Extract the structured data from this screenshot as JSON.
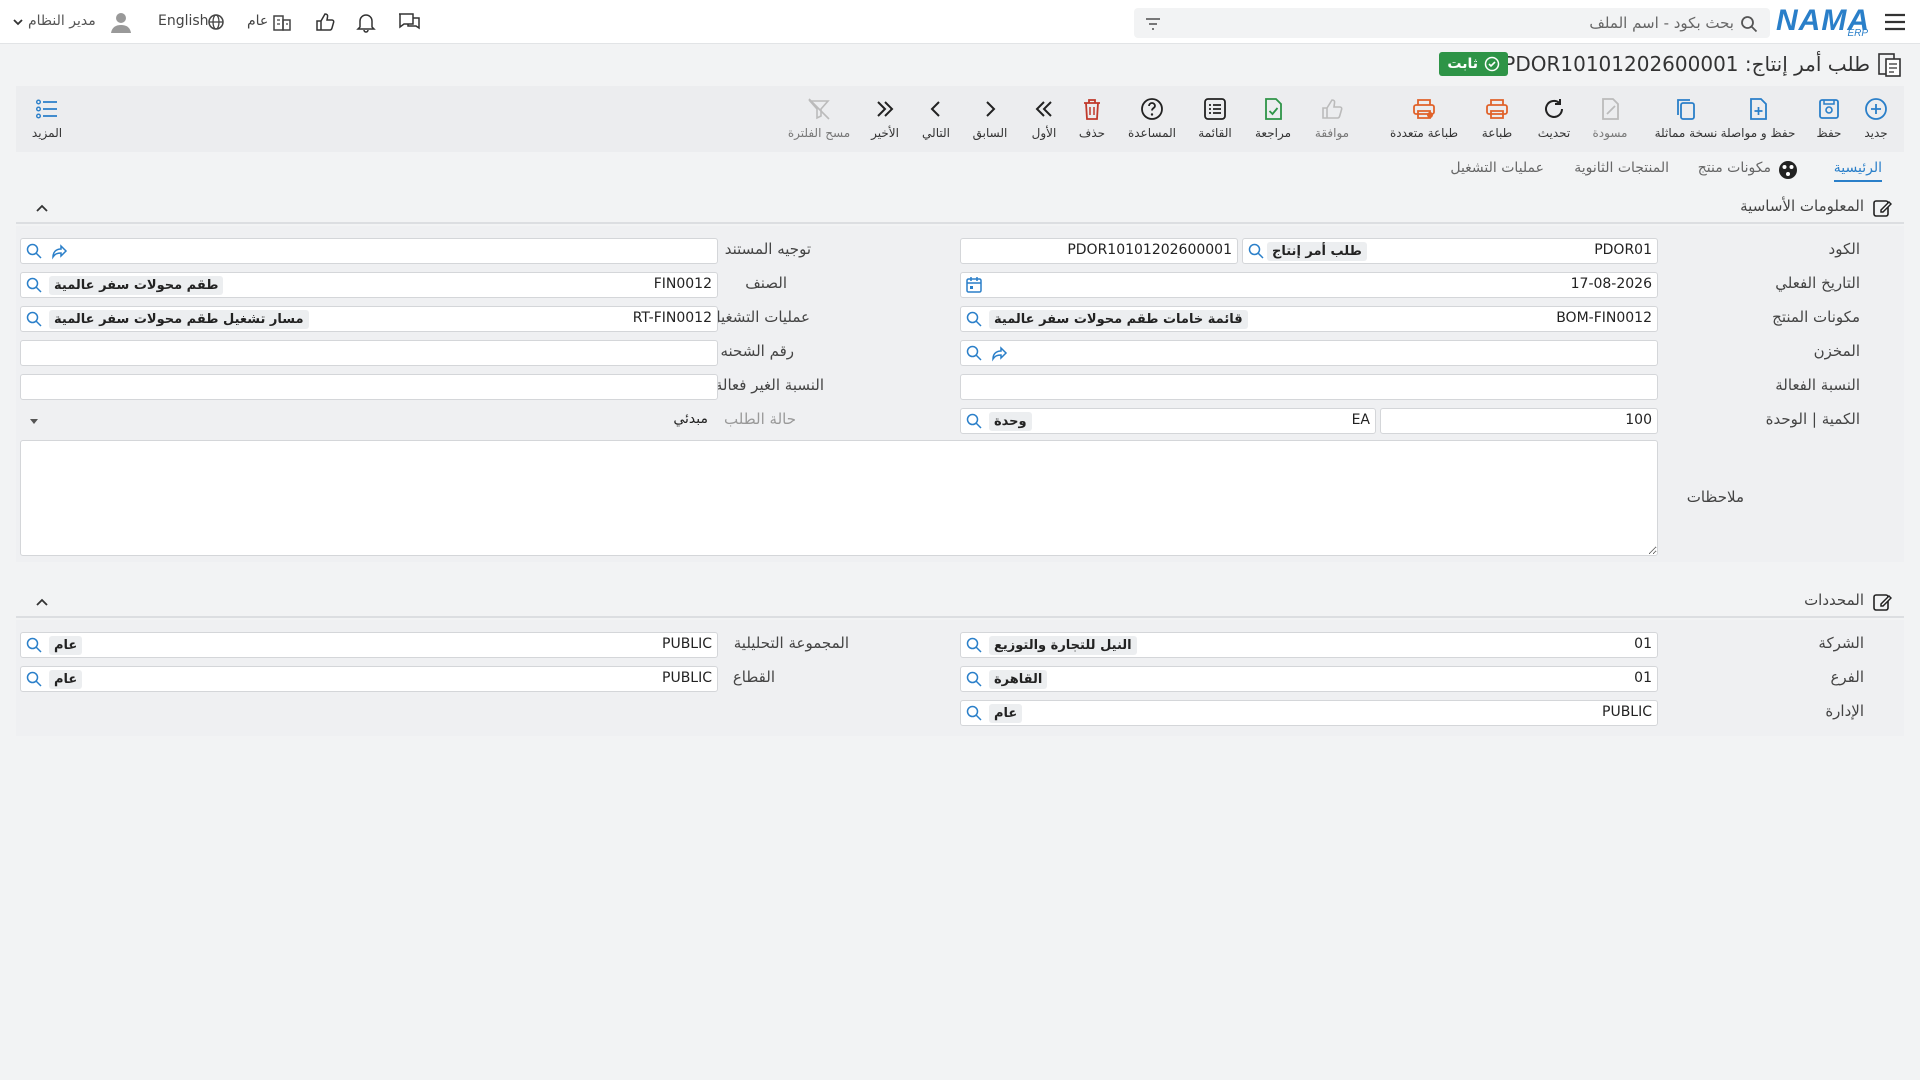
{
  "header": {
    "logo_main": "NAMA",
    "logo_sub": "ERP",
    "search_placeholder": "بحث بكود - اسم الملف",
    "user_name": "مدير النظام",
    "language": "English",
    "public_label": "عام"
  },
  "page": {
    "title": "طلب أمر إنتاج: PDOR10101202600001",
    "status": "ثابت"
  },
  "toolbar": {
    "new": "جديد",
    "save": "حفظ",
    "save_continue": "حفظ و مواصلة",
    "copy": "نسخة مماثلة",
    "draft": "مسودة",
    "refresh": "تحديث",
    "print": "طباعة",
    "multi_print": "طباعة متعددة",
    "approve": "موافقة",
    "review": "مراجعة",
    "list": "القائمة",
    "help": "المساعدة",
    "delete": "حذف",
    "first": "الأول",
    "prev": "السابق",
    "next": "التالي",
    "last": "الأخير",
    "clear_filter": "مسح الفلترة",
    "more": "المزيد"
  },
  "tabs": [
    "الرئيسية",
    "مكونات منتج",
    "المنتجات الثانوية",
    "عمليات التشغيل"
  ],
  "basic": {
    "title": "المعلومات الأساسية",
    "code_label": "الكود",
    "code_value": "PDOR01",
    "code_type": "طلب أمر إنتاج",
    "code_number": "PDOR10101202600001",
    "doc_route_label": "توجيه المستند",
    "date_label": "التاريخ الفعلي",
    "date_value": "17-08-2026",
    "item_label": "الصنف",
    "item_code": "FIN0012",
    "item_name": "طقم محولات سفر عالمية",
    "bom_label": "مكونات المنتج",
    "bom_code": "BOM-FIN0012",
    "bom_name": "قائمة خامات طقم محولات سفر عالمية",
    "ops_label": "عمليات التشغيل",
    "ops_code": "RT-FIN0012",
    "ops_name": "مسار تشغيل طقم محولات سفر عالمية",
    "warehouse_label": "المخزن",
    "shipment_label": "رقم الشحنه",
    "eff_label": "النسبة الفعالة",
    "ineff_label": "النسبة الغير فعالة",
    "qty_label": "الكمية | الوحدة",
    "qty_value": "100",
    "unit_code": "EA",
    "unit_name": "وحدة",
    "status_label": "حالة الطلب",
    "status_value": "مبدئي",
    "notes_label": "ملاحظات"
  },
  "dims": {
    "title": "المحددات",
    "company_label": "الشركة",
    "company_code": "01",
    "company_name": "النيل للتجارة والتوزيع",
    "analytic_label": "المجموعة التحليلية",
    "analytic_code": "PUBLIC",
    "analytic_name": "عام",
    "branch_label": "الفرع",
    "branch_code": "01",
    "branch_name": "القاهرة",
    "sector_label": "القطاع",
    "sector_code": "PUBLIC",
    "sector_name": "عام",
    "dept_label": "الإدارة",
    "dept_code": "PUBLIC",
    "dept_name": "عام"
  }
}
